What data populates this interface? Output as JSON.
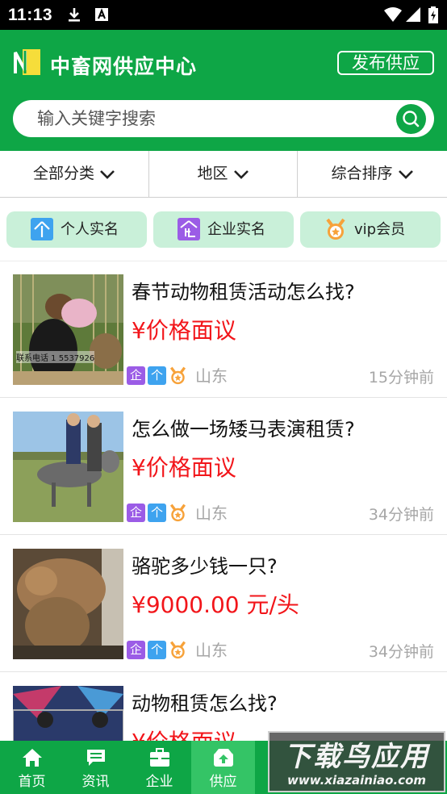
{
  "status_bar": {
    "time": "11:13"
  },
  "header": {
    "logo_letter": "N",
    "title": "中畜网供应中心",
    "publish_label": "发布供应"
  },
  "search": {
    "placeholder": "输入关键字搜索"
  },
  "filters": [
    {
      "label": "全部分类"
    },
    {
      "label": "地区"
    },
    {
      "label": "综合排序"
    }
  ],
  "chips": [
    {
      "label": "个人实名",
      "icon": "person-verified-icon",
      "icon_char": "个",
      "color": "#3ea3ef"
    },
    {
      "label": "企业实名",
      "icon": "enterprise-verified-icon",
      "icon_char": "企",
      "color": "#9b5ce6"
    },
    {
      "label": "vip会员",
      "icon": "vip-medal-icon",
      "icon_char": "★",
      "color": "#f7a23a"
    }
  ],
  "items": [
    {
      "title": "春节动物租赁活动怎么找?",
      "price": "¥价格面议",
      "region": "山东",
      "time": "15分钟前",
      "image_caption": "联系电话 1  5537926"
    },
    {
      "title": "怎么做一场矮马表演租赁?",
      "price": "¥价格面议",
      "region": "山东",
      "time": "34分钟前"
    },
    {
      "title": "骆驼多少钱一只?",
      "price": "¥9000.00 元/头",
      "region": "山东",
      "time": "34分钟前"
    },
    {
      "title": "动物租赁怎么找?",
      "price": "¥价格面议",
      "region": "",
      "time": ""
    }
  ],
  "badge_chars": {
    "enterprise": "企",
    "person": "个"
  },
  "bottom_nav": [
    {
      "label": "首页",
      "icon": "home-icon"
    },
    {
      "label": "资讯",
      "icon": "news-icon"
    },
    {
      "label": "企业",
      "icon": "briefcase-icon"
    },
    {
      "label": "供应",
      "icon": "supply-icon",
      "active": true
    }
  ],
  "watermark": {
    "title": "下载鸟应用",
    "url": "www.xiazainiao.com"
  },
  "colors": {
    "brand_green": "#0ea646",
    "price_red": "#f2151a",
    "chip_bg": "#c9f0d9"
  }
}
